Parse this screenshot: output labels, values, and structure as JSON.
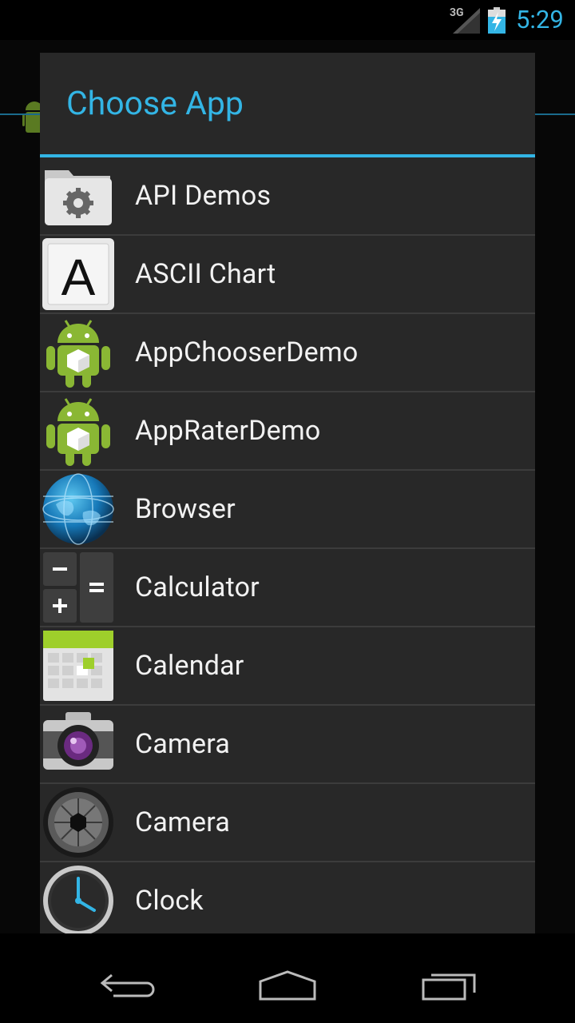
{
  "status_bar": {
    "network": "3G",
    "time": "5:29",
    "accent_color": "#33b5e5"
  },
  "dialog": {
    "title": "Choose App",
    "items": [
      {
        "label": "API Demos",
        "icon": "folder-gear-icon"
      },
      {
        "label": "ASCII Chart",
        "icon": "letter-a-icon"
      },
      {
        "label": "AppChooserDemo",
        "icon": "android-robot-icon"
      },
      {
        "label": "AppRaterDemo",
        "icon": "android-robot-icon"
      },
      {
        "label": "Browser",
        "icon": "globe-icon"
      },
      {
        "label": "Calculator",
        "icon": "calculator-icon"
      },
      {
        "label": "Calendar",
        "icon": "calendar-icon"
      },
      {
        "label": "Camera",
        "icon": "camera-icon"
      },
      {
        "label": "Camera",
        "icon": "camera-shutter-icon"
      },
      {
        "label": "Clock",
        "icon": "clock-icon"
      }
    ]
  },
  "nav_bar": {
    "buttons": [
      "back-icon",
      "home-icon",
      "recent-apps-icon"
    ]
  }
}
